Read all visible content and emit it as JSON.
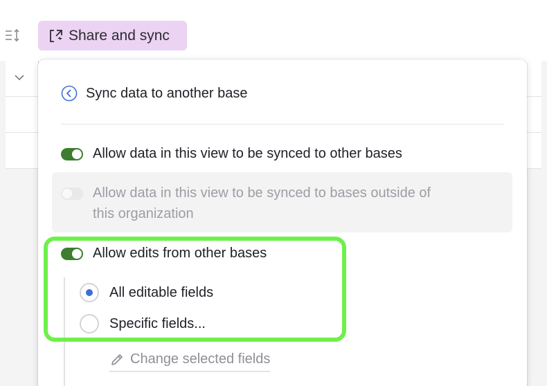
{
  "toolbar": {
    "sort_icon": "sort-lines-icon",
    "share_button_label": "Share and sync",
    "share_icon": "share-sync-icon"
  },
  "popover": {
    "back_icon": "chevron-left-circle-icon",
    "title": "Sync data to another base",
    "options": {
      "allow_sync_label": "Allow data in this view to be synced to other bases",
      "allow_sync_on": true,
      "allow_outside_label_line1": "Allow data in this view to be synced to bases outside of",
      "allow_outside_label_line2": "this organization",
      "allow_outside_on": false,
      "allow_edits_label": "Allow edits from other bases",
      "allow_edits_on": true
    },
    "edit_scope": {
      "all_fields_label": "All editable fields",
      "specific_fields_label": "Specific fields...",
      "selected": "all"
    },
    "change_fields_label": "Change selected fields",
    "change_fields_icon": "pencil-icon"
  },
  "colors": {
    "share_button_bg": "#ecd3f3",
    "toggle_on": "#3c7d2f",
    "radio_selected": "#3f6fd6",
    "highlight_border": "#6ef04a"
  }
}
